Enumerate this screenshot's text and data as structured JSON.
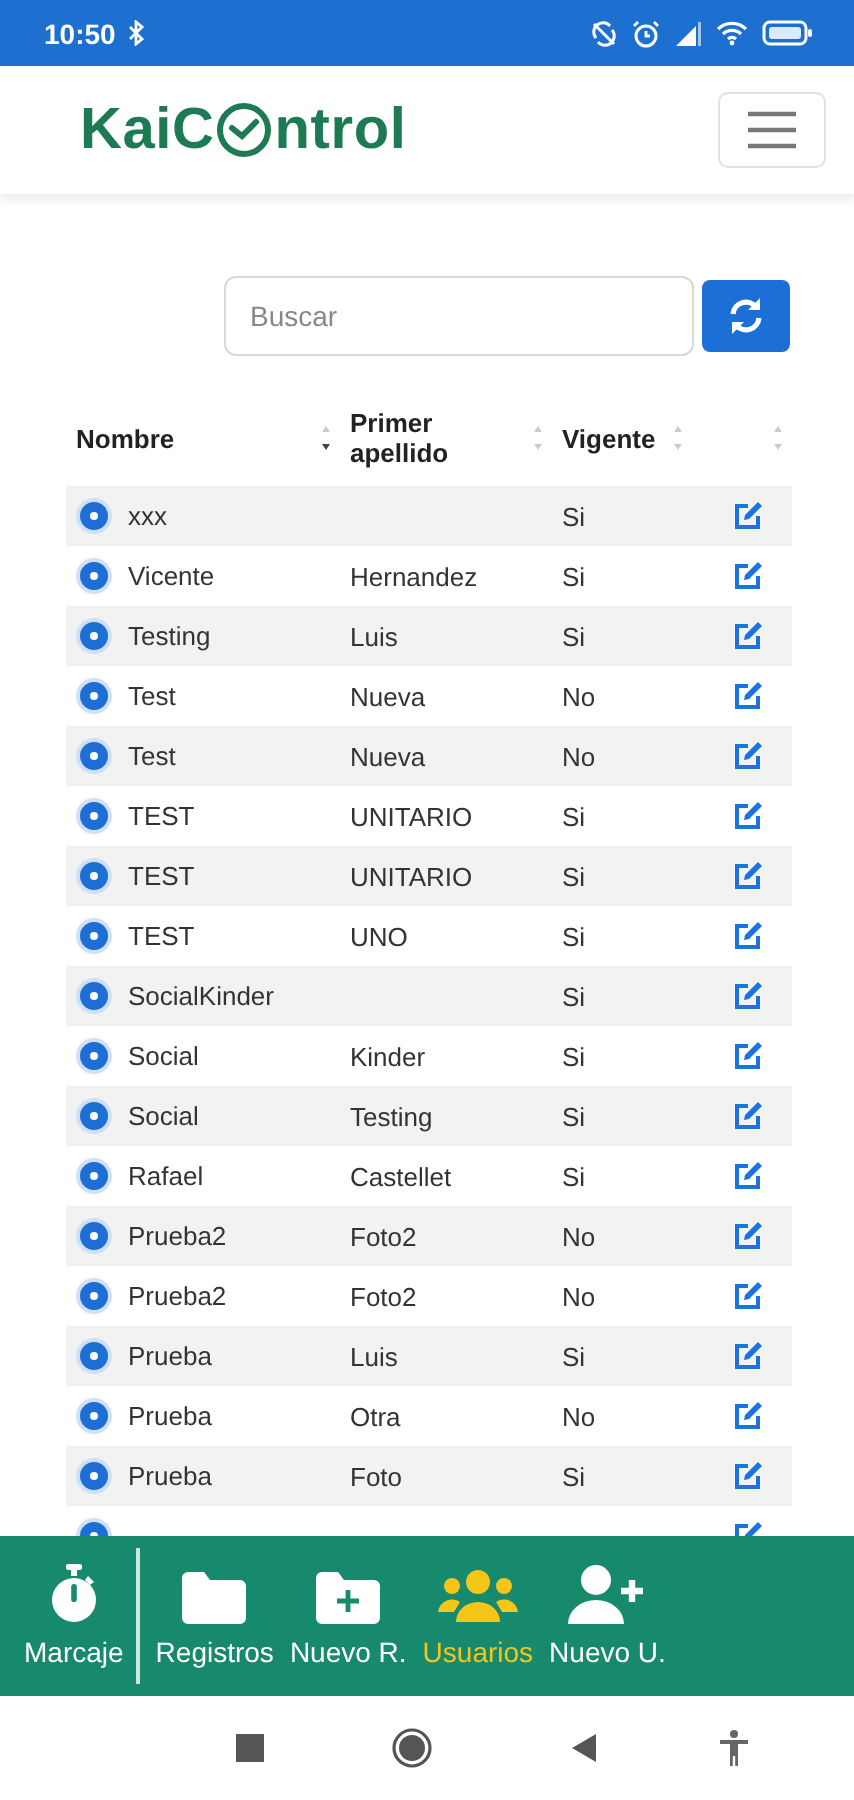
{
  "status_bar": {
    "time": "10:50"
  },
  "header": {
    "logo_before": "KaiC",
    "logo_after": "ntrol"
  },
  "search": {
    "placeholder": "Buscar"
  },
  "table": {
    "columns": [
      {
        "label": "Nombre",
        "sorted": true
      },
      {
        "label": "Primer apellido",
        "sorted": false
      },
      {
        "label": "Vigente",
        "sorted": false
      },
      {
        "sorted": false
      }
    ],
    "rows": [
      {
        "nombre": "xxx",
        "vigente": "Si"
      },
      {
        "nombre": "Vicente",
        "apellido": "Hernandez",
        "vigente": "Si"
      },
      {
        "nombre": "Testing",
        "apellido": "Luis",
        "vigente": "Si"
      },
      {
        "nombre": "Test",
        "apellido": "Nueva",
        "vigente": "No"
      },
      {
        "nombre": "Test",
        "apellido": "Nueva",
        "vigente": "No"
      },
      {
        "nombre": "TEST",
        "apellido": "UNITARIO",
        "vigente": "Si"
      },
      {
        "nombre": "TEST",
        "apellido": "UNITARIO",
        "vigente": "Si"
      },
      {
        "nombre": "TEST",
        "apellido": "UNO",
        "vigente": "Si"
      },
      {
        "nombre": "SocialKinder",
        "vigente": "Si"
      },
      {
        "nombre": "Social",
        "apellido": "Kinder",
        "vigente": "Si"
      },
      {
        "nombre": "Social",
        "apellido": "Testing",
        "vigente": "Si"
      },
      {
        "nombre": "Rafael",
        "apellido": "Castellet",
        "vigente": "Si"
      },
      {
        "nombre": "Prueba2",
        "apellido": "Foto2",
        "vigente": "No"
      },
      {
        "nombre": "Prueba2",
        "apellido": "Foto2",
        "vigente": "No"
      },
      {
        "nombre": "Prueba",
        "apellido": "Luis",
        "vigente": "Si"
      },
      {
        "nombre": "Prueba",
        "apellido": "Otra",
        "vigente": "No"
      },
      {
        "nombre": "Prueba",
        "apellido": "Foto",
        "vigente": "Si"
      },
      {}
    ]
  },
  "bottom_nav": [
    {
      "label": "Marcaje",
      "kind": "stopwatch",
      "selected": false
    },
    {
      "label": "Registros",
      "kind": "folder",
      "selected": false
    },
    {
      "label": "Nuevo R.",
      "kind": "folder-plus",
      "selected": false
    },
    {
      "label": "Usuarios",
      "kind": "users",
      "selected": true
    },
    {
      "label": "Nuevo U.",
      "kind": "user-plus",
      "selected": false
    }
  ]
}
